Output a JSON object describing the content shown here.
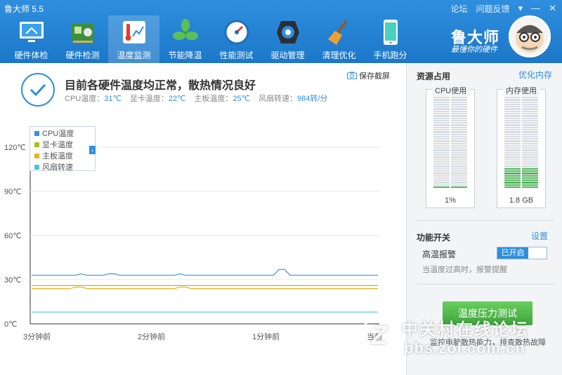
{
  "app": {
    "title": "鲁大师 5.5",
    "brand": "鲁大师",
    "slogan": "最懂你的硬件"
  },
  "top_links": {
    "forum": "论坛",
    "feedback": "问题反馈",
    "menu": "▾",
    "minimize": "—",
    "close": "✕"
  },
  "nav": [
    {
      "label": "硬件体检",
      "icon": "hardware-checkup-icon"
    },
    {
      "label": "硬件检测",
      "icon": "hardware-detect-icon"
    },
    {
      "label": "温度监测",
      "icon": "temperature-monitor-icon",
      "active": true
    },
    {
      "label": "节能降温",
      "icon": "energy-save-fan-icon"
    },
    {
      "label": "性能测试",
      "icon": "performance-gauge-icon"
    },
    {
      "label": "驱动管理",
      "icon": "driver-manage-icon"
    },
    {
      "label": "清理优化",
      "icon": "cleanup-broom-icon"
    },
    {
      "label": "手机跑分",
      "icon": "phone-benchmark-icon"
    }
  ],
  "status": {
    "headline": "目前各硬件温度均正常，散热情况良好",
    "cpu_label": "CPU温度：",
    "cpu_value": "31℃",
    "gpu_label": "显卡温度：",
    "gpu_value": "22℃",
    "board_label": "主板温度：",
    "board_value": "25℃",
    "fan_label": "风扇转速：",
    "fan_value": "984转/分",
    "screenshot_label": "保存截屏"
  },
  "chart_data": {
    "type": "line",
    "y_ticks": [
      "120℃",
      "90℃",
      "60℃",
      "30℃",
      "0℃"
    ],
    "x_ticks": [
      "3分钟前",
      "2分钟前",
      "1分钟前",
      "当前"
    ],
    "ylim": [
      0,
      120
    ],
    "legend_position": "top-left",
    "series": [
      {
        "name": "CPU温度",
        "color": "#3b8fe0",
        "values": [
          33,
          33,
          33,
          33,
          33,
          33,
          33,
          33,
          33,
          34,
          33,
          33,
          33,
          33,
          34,
          34,
          33,
          33,
          33,
          33,
          33,
          33,
          33,
          33,
          33,
          33,
          33,
          34,
          33,
          33,
          33,
          33,
          33,
          33,
          33,
          33,
          33,
          33,
          33,
          33,
          33,
          33,
          33,
          33,
          33,
          37,
          37,
          33,
          33,
          33,
          33,
          33,
          33,
          33,
          33,
          33,
          33,
          33,
          33,
          33,
          33,
          33,
          33,
          33
        ]
      },
      {
        "name": "显卡温度",
        "color": "#a6c21d",
        "values": [
          26,
          26,
          26,
          26,
          26,
          26,
          26,
          26,
          26,
          26,
          26,
          26,
          26,
          26,
          26,
          26,
          26,
          26,
          26,
          26,
          26,
          26,
          26,
          26,
          26,
          26,
          26,
          26,
          26,
          26,
          26,
          26,
          26,
          26,
          26,
          26,
          26,
          26,
          26,
          26,
          26,
          26,
          26,
          26,
          26,
          26,
          26,
          26,
          26,
          26,
          26,
          26,
          26,
          26,
          26,
          26,
          26,
          26,
          26,
          26,
          26,
          26,
          26,
          26
        ]
      },
      {
        "name": "主板温度",
        "color": "#f0b020",
        "values": [
          24,
          24,
          24,
          24,
          24,
          24,
          24,
          24,
          25,
          25,
          24,
          24,
          24,
          24,
          24,
          24,
          24,
          24,
          24,
          24,
          24,
          24,
          24,
          24,
          24,
          24,
          24,
          25,
          25,
          24,
          24,
          24,
          24,
          24,
          24,
          24,
          24,
          24,
          24,
          24,
          24,
          24,
          24,
          24,
          24,
          24,
          24,
          24,
          24,
          24,
          24,
          24,
          24,
          24,
          24,
          24,
          24,
          24,
          24,
          24,
          24,
          24,
          24,
          24
        ]
      },
      {
        "name": "风扇转速",
        "color": "#4cc3e0",
        "values": [
          8,
          8,
          8,
          8,
          8,
          8,
          8,
          8,
          8,
          8,
          8,
          8,
          8,
          8,
          8,
          8,
          8,
          8,
          8,
          8,
          8,
          8,
          8,
          8,
          8,
          8,
          8,
          8,
          8,
          8,
          8,
          8,
          8,
          8,
          8,
          8,
          8,
          8,
          8,
          8,
          8,
          8,
          8,
          8,
          8,
          8,
          8,
          8,
          8,
          8,
          8,
          8,
          8,
          8,
          8,
          8,
          8,
          8,
          8,
          8,
          8,
          8,
          8,
          8
        ]
      }
    ]
  },
  "resources": {
    "title": "资源占用",
    "optimize_link": "优化内存",
    "cpu": {
      "label": "CPU使用",
      "value": "1%",
      "level": 0.01
    },
    "memory": {
      "label": "内存使用",
      "value": "1.8 GB",
      "level": 0.23
    }
  },
  "features": {
    "title": "功能开关",
    "settings_link": "设置",
    "alarm_label": "高温报警",
    "alarm_state": "已开启",
    "alarm_desc": "当温度过高时，报警提醒"
  },
  "stress": {
    "button": "温度压力测试",
    "desc": "监控电脑散热能力，排查散热故障"
  },
  "watermark": {
    "line1": "中关村在线论坛",
    "line2": "bbs.zol.com.cn",
    "z": "Z"
  }
}
